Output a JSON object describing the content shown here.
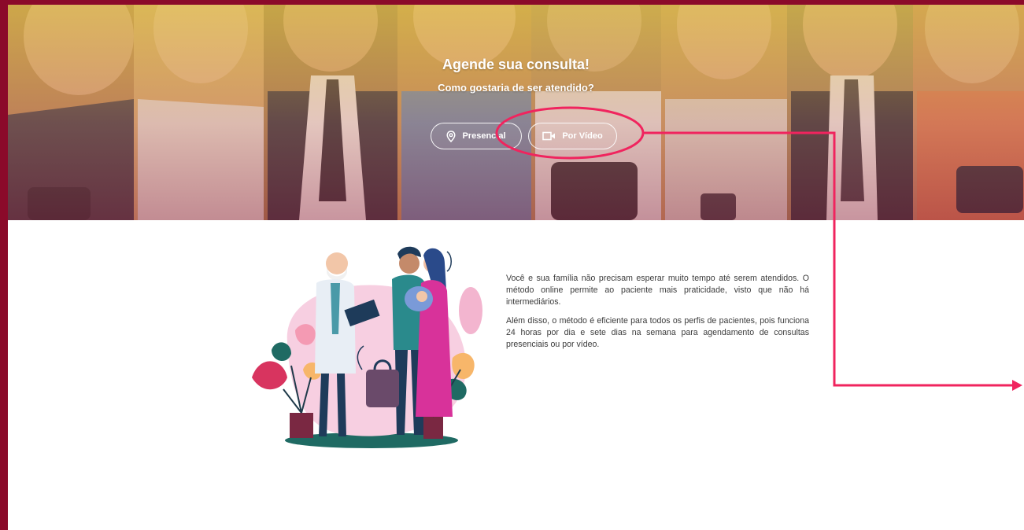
{
  "hero": {
    "title": "Agende sua consulta!",
    "subtitle": "Como gostaria de ser atendido?",
    "buttons": [
      {
        "label": "Presencial",
        "icon": "map-pin-icon"
      },
      {
        "label": "Por Vídeo",
        "icon": "video-camera-icon"
      }
    ]
  },
  "content": {
    "paragraphs": [
      "Você e sua família não precisam esperar muito tempo até serem atendidos. O método online permite ao paciente mais praticidade, visto que não há intermediários.",
      "Além disso, o método é eficiente para todos os perfis de pacientes, pois funciona 24 horas por dia e sete dias na semana para agendamento de consultas presenciais ou por vídeo."
    ]
  },
  "colors": {
    "frame": "#8b0a2a",
    "annotation": "#f0245e",
    "text": "#3b3b3b"
  }
}
